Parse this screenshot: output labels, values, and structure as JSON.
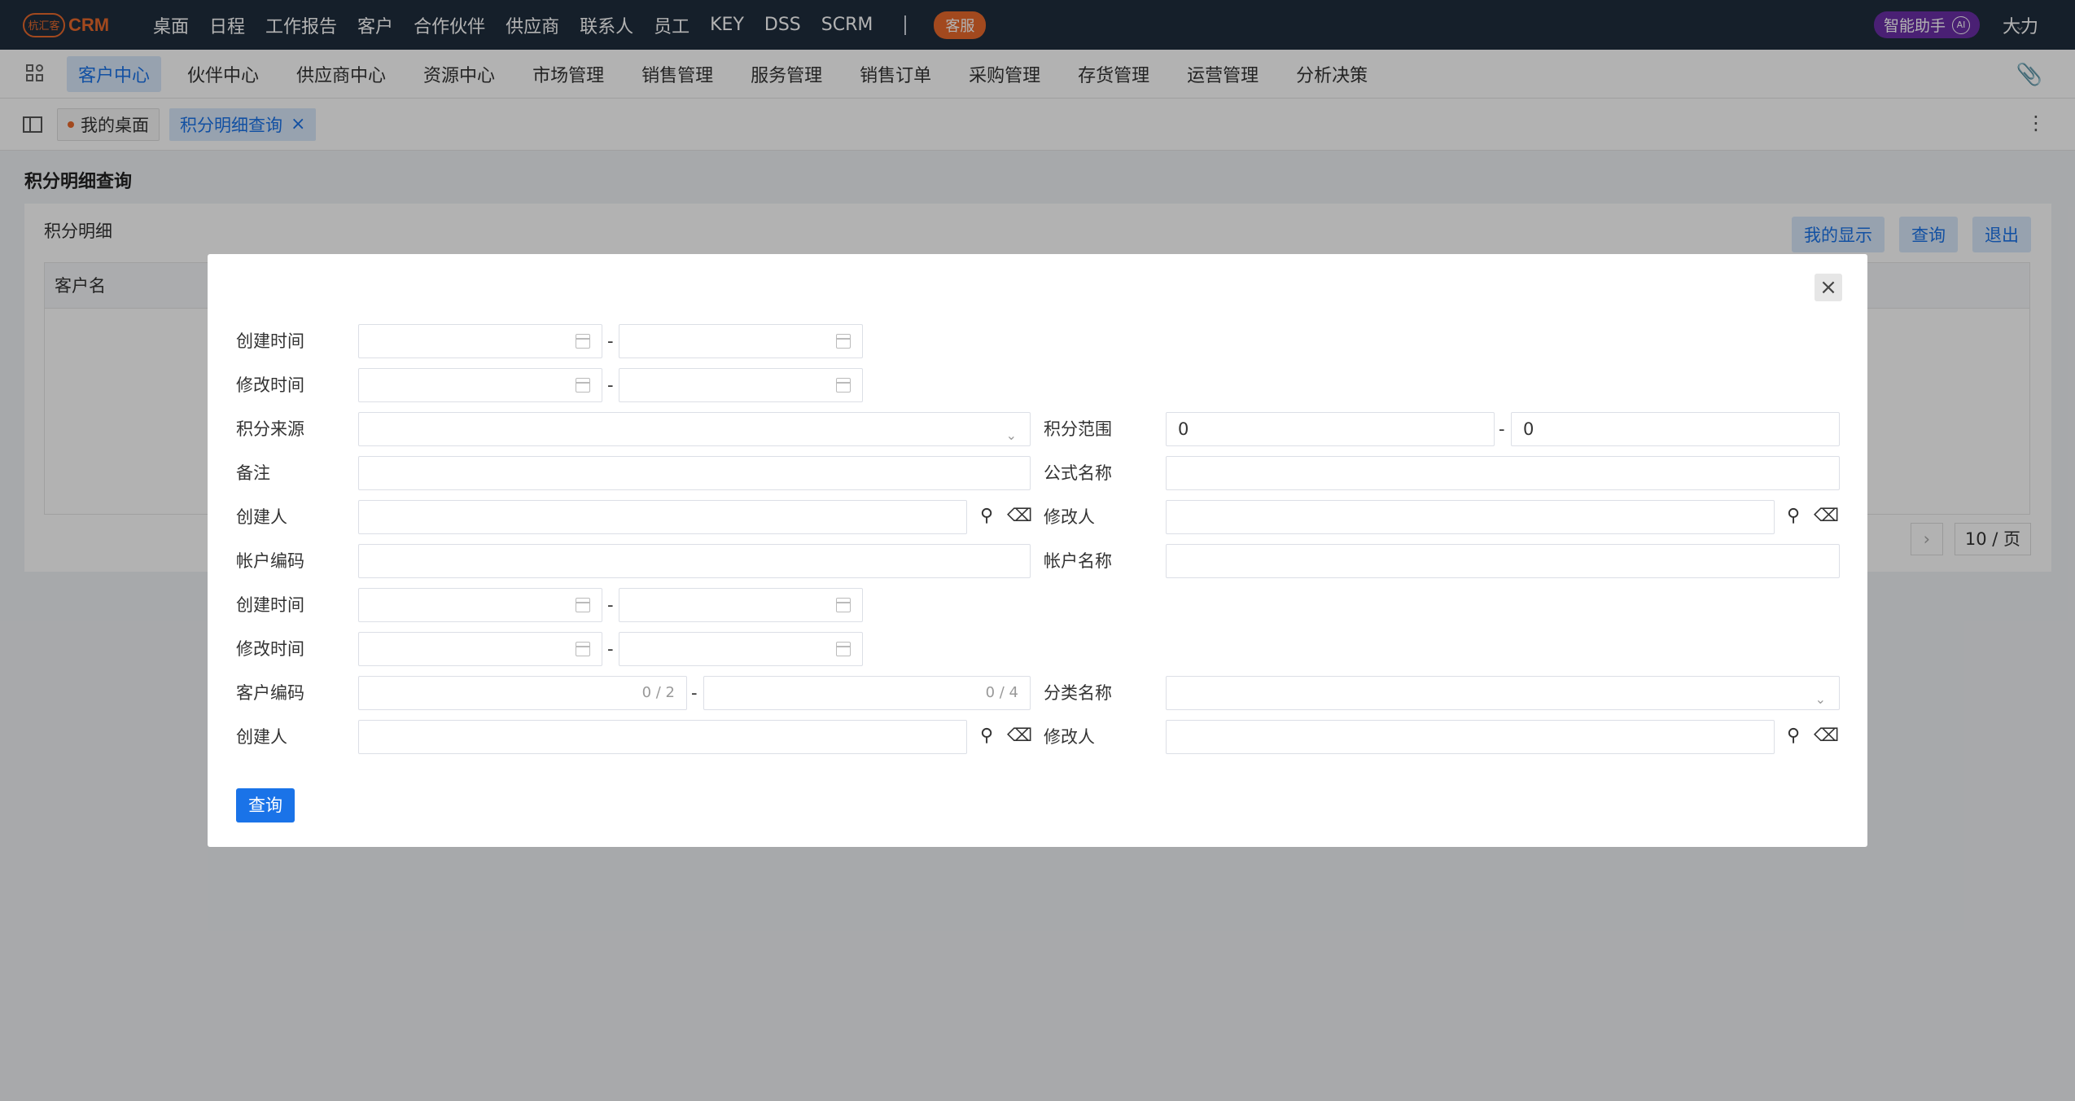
{
  "topbar": {
    "logo_mark": "杭汇客",
    "logo_text": "CRM",
    "nav": [
      "桌面",
      "日程",
      "工作报告",
      "客户",
      "合作伙伴",
      "供应商",
      "联系人",
      "员工",
      "KEY",
      "DSS",
      "SCRM"
    ],
    "kefu": "客服",
    "ai_assistant": "智能助手",
    "ai_badge": "AI",
    "user": "大力"
  },
  "modules": [
    "客户中心",
    "伙伴中心",
    "供应商中心",
    "资源中心",
    "市场管理",
    "销售管理",
    "服务管理",
    "销售订单",
    "采购管理",
    "存货管理",
    "运营管理",
    "分析决策"
  ],
  "tabs": {
    "desk": "我的桌面",
    "active": "积分明细查询"
  },
  "page": {
    "title": "积分明细查询",
    "card_title": "积分明细",
    "btn_display": "我的显示",
    "btn_query": "查询",
    "btn_exit": "退出",
    "col_customer": "客户名",
    "page_size": "10 / 页"
  },
  "modal": {
    "labels": {
      "created_time": "创建时间",
      "modified_time": "修改时间",
      "points_source": "积分来源",
      "points_range": "积分范围",
      "remark": "备注",
      "formula_name": "公式名称",
      "creator": "创建人",
      "modifier": "修改人",
      "account_code": "帐户编码",
      "account_name": "帐户名称",
      "customer_code": "客户编码",
      "category_name": "分类名称"
    },
    "dash": "-",
    "points_from": "0",
    "points_to": "0",
    "code_counter_1": "0 / 2",
    "code_counter_2": "0 / 4",
    "query_button": "查询"
  }
}
